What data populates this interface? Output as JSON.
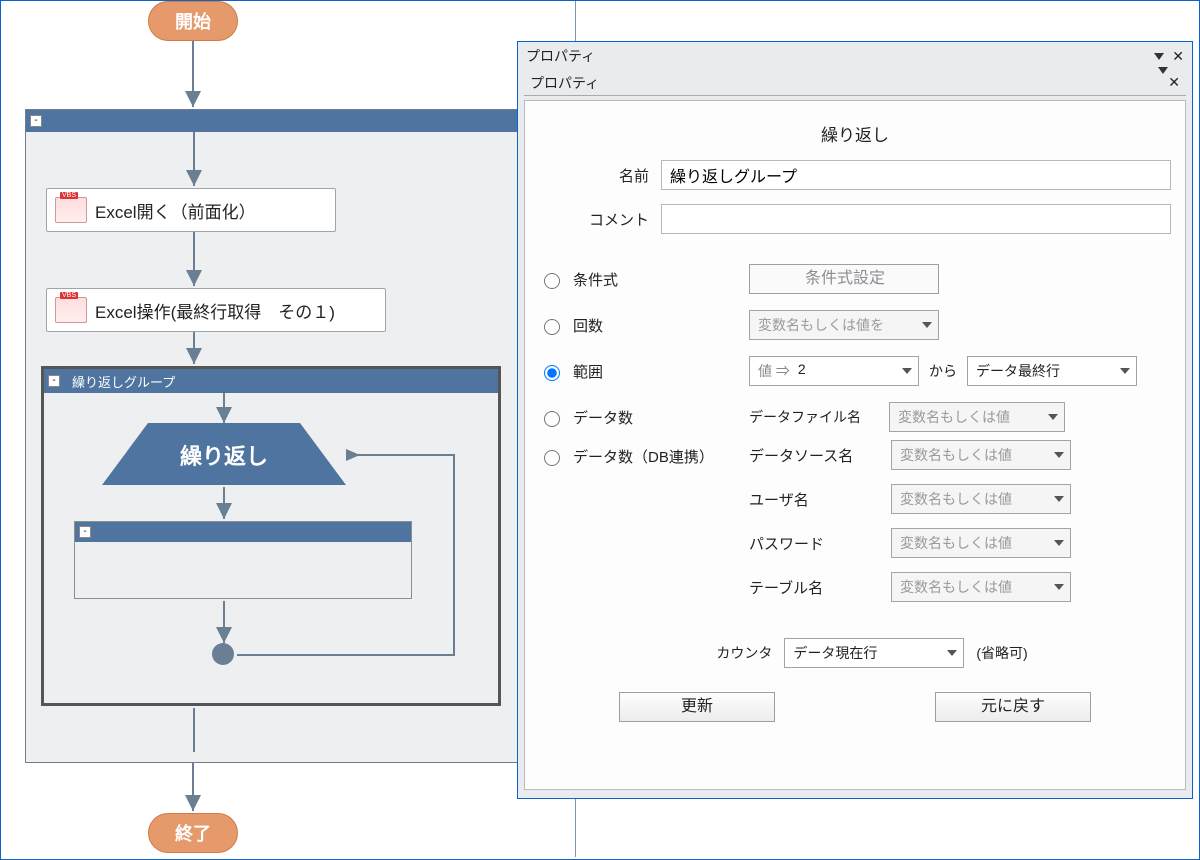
{
  "flow": {
    "start": "開始",
    "end": "終了",
    "step1": "Excel開く（前面化）",
    "step2": "Excel操作(最終行取得　その１)",
    "loopGroup": {
      "header": "繰り返しグループ",
      "shapeLabel": "繰り返し"
    }
  },
  "panel": {
    "outerTitle": "プロパティ",
    "innerTitle": "プロパティ",
    "sectionTitle": "繰り返し",
    "form": {
      "nameLabel": "名前",
      "nameValue": "繰り返しグループ",
      "commentLabel": "コメント",
      "commentValue": ""
    },
    "modes": {
      "condition": {
        "label": "条件式",
        "button": "条件式設定"
      },
      "count": {
        "label": "回数",
        "placeholder": "変数名もしくは値を"
      },
      "range": {
        "label": "範囲",
        "fromPrefix": "値 ⇒",
        "fromValue": "2",
        "between": "から",
        "toValue": "データ最終行"
      },
      "dataCount": {
        "label": "データ数",
        "fileLabel": "データファイル名",
        "placeholder": "変数名もしくは値"
      },
      "dataDb": {
        "label": "データ数（DB連携）",
        "rows": [
          {
            "label": "データソース名",
            "placeholder": "変数名もしくは値"
          },
          {
            "label": "ユーザ名",
            "placeholder": "変数名もしくは値"
          },
          {
            "label": "パスワード",
            "placeholder": "変数名もしくは値"
          },
          {
            "label": "テーブル名",
            "placeholder": "変数名もしくは値"
          }
        ]
      }
    },
    "counter": {
      "label": "カウンタ",
      "value": "データ現在行",
      "hint": "(省略可)"
    },
    "buttons": {
      "update": "更新",
      "revert": "元に戻す"
    }
  }
}
